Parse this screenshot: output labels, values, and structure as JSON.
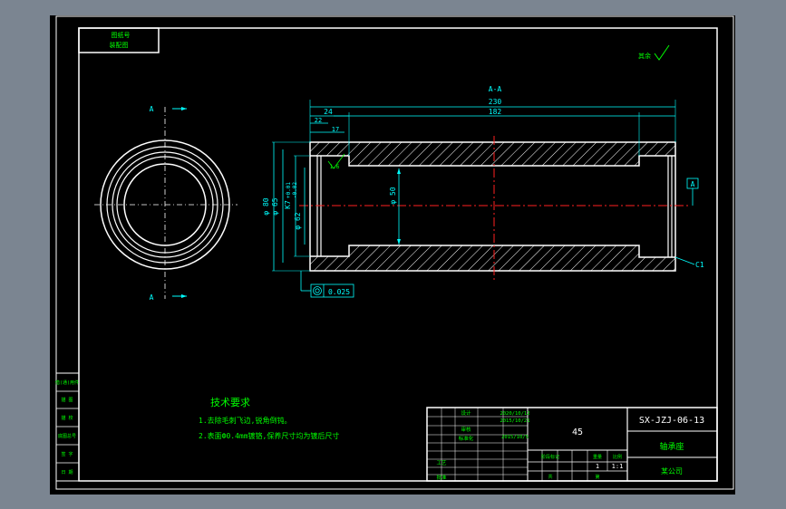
{
  "view": {
    "section_label": "A-A",
    "cut_mark_top": "A",
    "cut_mark_bottom": "A"
  },
  "dimensions": {
    "overall_length": "230",
    "inner_length": "182",
    "left_offset_24": "24",
    "left_offset_22": "22",
    "left_offset_17": "17",
    "dia_80": "φ 80",
    "dia_65": "φ 65",
    "bore_fit": "K7",
    "bore_fit_upper": "+0.01",
    "bore_fit_lower": "-0.02",
    "dia_62": "φ 62",
    "dia_50": "φ 50",
    "roughness_value": "1.6",
    "chamfer": "C1",
    "datum_label": "A",
    "tolerance_value": "0.025",
    "roughness_corner_label": "其余"
  },
  "stamp_top_left": {
    "line1": "图纸号",
    "line2": "装配图"
  },
  "tech_requirements": {
    "heading": "技术要求",
    "item1": "1.去除毛刺飞边,锐角倒钝。",
    "item2": "2.表面Ф0.4mm镀铬,保养尺寸均为镀后尺寸"
  },
  "side_table": [
    "借(通)用件",
    "描  图",
    "描  校",
    "底图总号",
    "签  字",
    "日  期"
  ],
  "title_block": {
    "drawing_number": "SX-JZJ-06-13",
    "material": "45",
    "part_name": "轴承座",
    "company": "某公司",
    "date1": "2020/10/12",
    "date2": "2015/10/21",
    "date3": "2015/10/5",
    "role_design": "设计",
    "role_check": "审核",
    "role_std": "标准化",
    "role_tech": "工艺",
    "role_approve": "批准",
    "label_stage": "阶段标记",
    "label_weight": "重量",
    "label_scale": "比例",
    "scale_value": "1:1",
    "sheet_of": "共",
    "sheet_no": "第",
    "sheet_count": "1"
  }
}
